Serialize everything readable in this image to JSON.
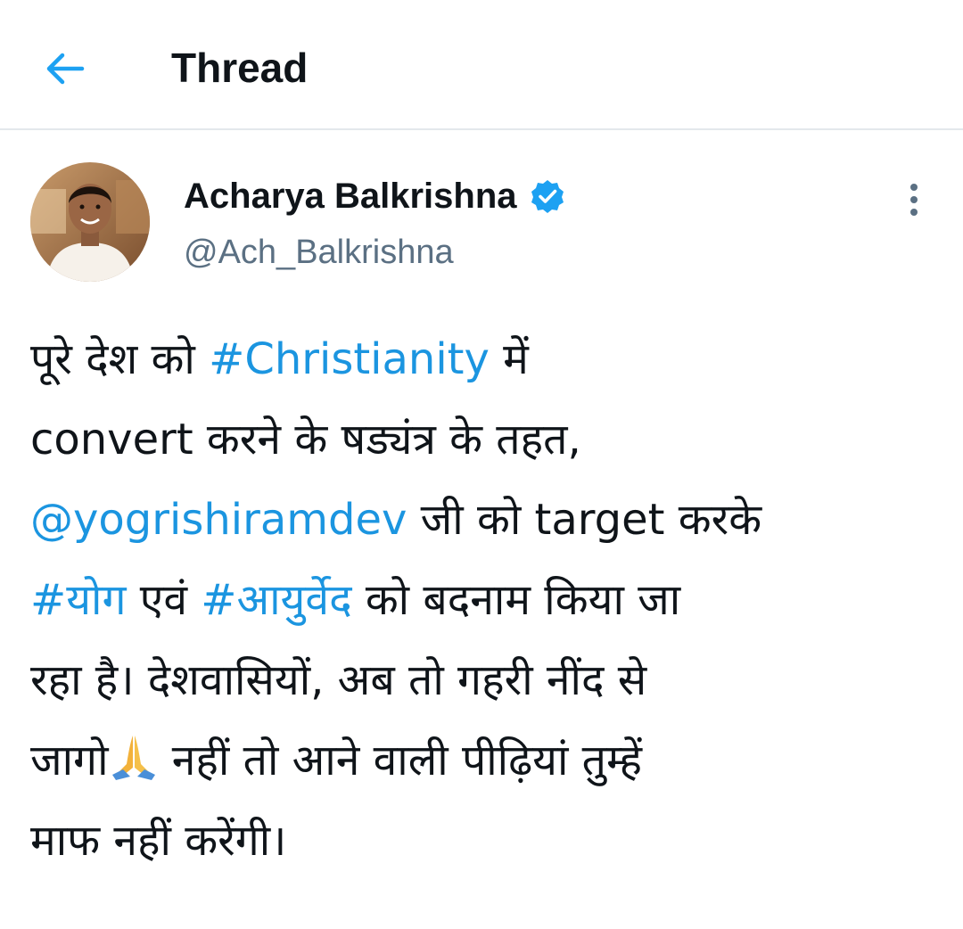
{
  "header": {
    "title": "Thread",
    "back_icon": "arrow-left-icon"
  },
  "tweet": {
    "author": {
      "display_name": "Acharya Balkrishna",
      "handle": "@Ach_Balkrishna",
      "verified_icon": "verified-badge-icon"
    },
    "more_icon": "more-vertical-icon",
    "lines": [
      [
        {
          "text": "पूरे देश को ",
          "link": false
        },
        {
          "text": "#Christianity",
          "link": true
        },
        {
          "text": " में",
          "link": false
        }
      ],
      [
        {
          "text": "convert करने के षड्यंत्र के तहत,",
          "link": false
        }
      ],
      [
        {
          "text": "@yogrishiramdev",
          "link": true
        },
        {
          "text": " जी को target करके",
          "link": false
        }
      ],
      [
        {
          "text": "#योग",
          "link": true
        },
        {
          "text": " एवं ",
          "link": false
        },
        {
          "text": "#आयुर्वेद",
          "link": true
        },
        {
          "text": " को बदनाम किया जा",
          "link": false
        }
      ],
      [
        {
          "text": "रहा है। देशवासियों, अब तो गहरी नींद से",
          "link": false
        }
      ],
      [
        {
          "text": "जागो",
          "link": false
        },
        {
          "emoji": "folded-hands-emoji"
        },
        {
          "text": " नहीं तो आने वाली पीढ़ियां तुम्हें",
          "link": false
        }
      ],
      [
        {
          "text": "माफ नहीं करेंगी।",
          "link": false
        }
      ]
    ]
  },
  "colors": {
    "link": "#1b95e0",
    "text": "#0f1419",
    "secondary": "#5b7083",
    "divider": "#e3e8ec",
    "verified": "#1da1f2"
  }
}
